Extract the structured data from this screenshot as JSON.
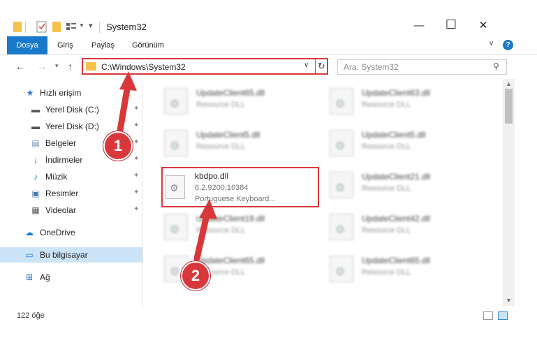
{
  "window": {
    "title": "System32",
    "minimize": "—",
    "maximize": "☐",
    "close": "✕"
  },
  "ribbon": {
    "tabs": [
      {
        "label": "Dosya",
        "active": true
      },
      {
        "label": "Giriş"
      },
      {
        "label": "Paylaş"
      },
      {
        "label": "Görünüm"
      }
    ],
    "help": "?"
  },
  "nav": {
    "address": "C:\\Windows\\System32",
    "search_placeholder": "Ara: System32"
  },
  "sidebar": {
    "items": [
      {
        "label": "Hızlı erişim",
        "icon": "star-icon"
      },
      {
        "label": "Yerel Disk (C:)",
        "icon": "drive-icon",
        "pinned": true
      },
      {
        "label": "Yerel Disk (D:)",
        "icon": "drive-icon",
        "pinned": true
      },
      {
        "label": "Belgeler",
        "icon": "document-icon",
        "pinned": true
      },
      {
        "label": "İndirmeler",
        "icon": "download-icon",
        "pinned": true
      },
      {
        "label": "Müzik",
        "icon": "music-icon",
        "pinned": true
      },
      {
        "label": "Resimler",
        "icon": "pictures-icon",
        "pinned": true
      },
      {
        "label": "Videolar",
        "icon": "video-icon",
        "pinned": true
      },
      {
        "label": "OneDrive",
        "icon": "cloud-icon"
      },
      {
        "label": "Bu bilgisayar",
        "icon": "computer-icon",
        "selected": true
      },
      {
        "label": "Ağ",
        "icon": "network-icon"
      }
    ]
  },
  "files": {
    "left": [
      {
        "name": "UpdateClient65.dll",
        "type": "Resource DLL"
      },
      {
        "name": "UpdateClient5.dll",
        "type": "Resource DLL"
      },
      {
        "name": "UpdateClient19.dll",
        "type": "Resource DLL"
      },
      {
        "name": "UpdateClient65.dll",
        "type": "Resource DLL"
      }
    ],
    "right": [
      {
        "name": "UpdateClient63.dll",
        "type": "Resource DLL"
      },
      {
        "name": "UpdateClient5.dll",
        "type": "Resource DLL"
      },
      {
        "name": "UpdateClient21.dll",
        "type": "Resource DLL"
      },
      {
        "name": "UpdateClient42.dll",
        "type": "Resource DLL"
      },
      {
        "name": "UpdateClient65.dll",
        "type": "Resource DLL"
      }
    ],
    "highlighted": {
      "name": "kbdpo.dll",
      "version": "6.2.9200.16384",
      "description": "Portuguese Keyboard..."
    }
  },
  "status": {
    "count": "122 öğe"
  },
  "annotations": {
    "step1": "1",
    "step2": "2",
    "color": "#d9383b"
  }
}
